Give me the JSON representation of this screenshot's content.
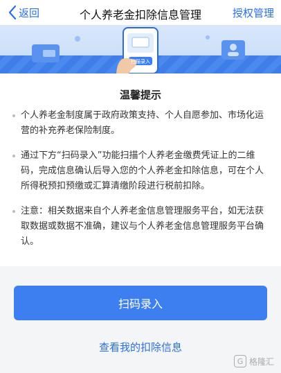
{
  "nav": {
    "back_label": "返回",
    "title": "个人养老金扣除信息管理",
    "right_label": "授权管理"
  },
  "banner": {
    "phone_button_text": "扫描录入"
  },
  "notice": {
    "title": "温馨提示",
    "paragraphs": [
      "个人养老金制度属于政府政策支持、个人自愿参加、市场化运营的补充养老保险制度。",
      "通过下方“扫码录入”功能扫描个人养老金缴费凭证上的二维码，完成信息确认后导入您的个人养老金扣除信息，可在个人所得税预扣预缴或汇算清缴阶段进行税前扣除。",
      "注意：相关数据来自个人养老金信息管理服务平台，如无法获取数据或数据不准确，建议与个人养老金信息管理服务平台确认。"
    ]
  },
  "actions": {
    "scan_button": "扫码录入",
    "view_link": "查看我的扣除信息"
  },
  "watermark": {
    "text": "格隆汇"
  },
  "colors": {
    "accent": "#2a6fe8",
    "button": "#3d7ff0",
    "banner": "#c4daf9"
  }
}
